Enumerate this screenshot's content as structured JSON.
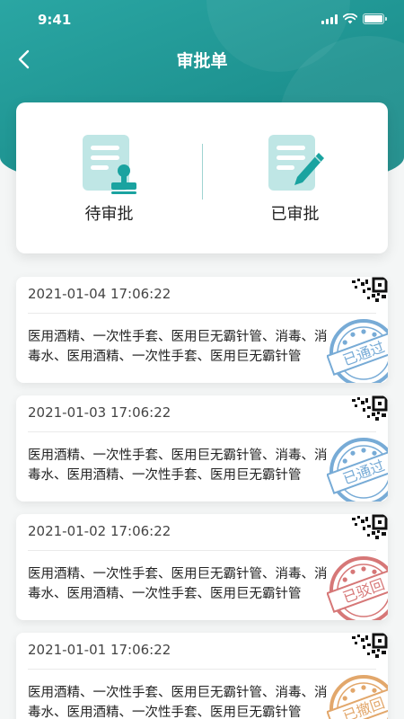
{
  "status_bar": {
    "time": "9:41"
  },
  "nav": {
    "title": "审批单"
  },
  "tabs": [
    {
      "label": "待审批",
      "icon": "document-stamp-icon"
    },
    {
      "label": "已审批",
      "icon": "document-edit-icon"
    }
  ],
  "items": [
    {
      "date": "2021-01-04 17:06:22",
      "desc": "医用酒精、一次性手套、医用巨无霸针管、消毒、消毒水、医用酒精、一次性手套、医用巨无霸针管",
      "stamp_text": "已通过",
      "stamp_color": "#4a8fc9"
    },
    {
      "date": "2021-01-03 17:06:22",
      "desc": "医用酒精、一次性手套、医用巨无霸针管、消毒、消毒水、医用酒精、一次性手套、医用巨无霸针管",
      "stamp_text": "已通过",
      "stamp_color": "#4a8fc9"
    },
    {
      "date": "2021-01-02 17:06:22",
      "desc": "医用酒精、一次性手套、医用巨无霸针管、消毒、消毒水、医用酒精、一次性手套、医用巨无霸针管",
      "stamp_text": "已驳回",
      "stamp_color": "#c94a4a"
    },
    {
      "date": "2021-01-01 17:06:22",
      "desc": "医用酒精、一次性手套、医用巨无霸针管、消毒、消毒水、医用酒精、一次性手套、医用巨无霸针管",
      "stamp_text": "已撤回",
      "stamp_color": "#d98a3a"
    }
  ],
  "colors": {
    "primary": "#1d918f",
    "tab_icon": "#1aa3a0"
  }
}
